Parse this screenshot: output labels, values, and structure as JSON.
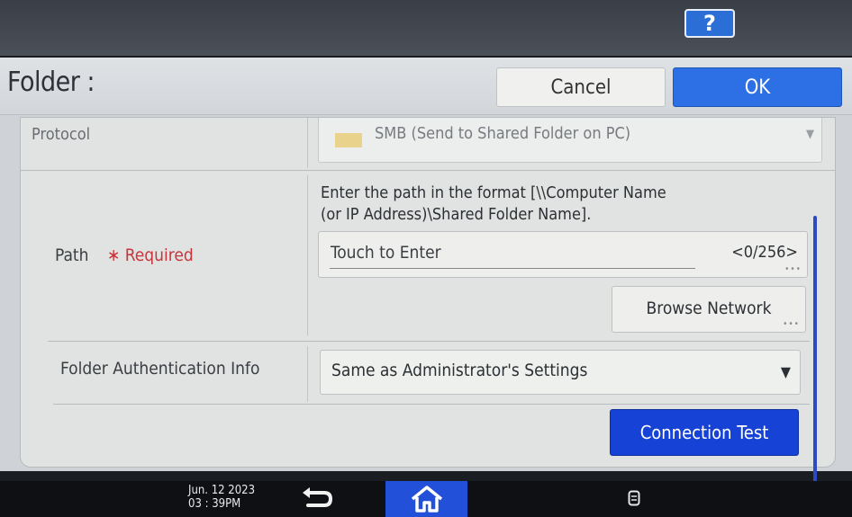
{
  "help_button_label": "?",
  "dialog": {
    "title": "Folder :",
    "cancel_label": "Cancel",
    "ok_label": "OK"
  },
  "protocol": {
    "label": "Protocol",
    "value": "SMB (Send to Shared Folder on PC)"
  },
  "path": {
    "label": "Path",
    "required_text": "∗ Required",
    "hint_line1": "Enter the path in the format [\\\\Computer Name",
    "hint_line2": "(or IP Address)\\Shared Folder Name].",
    "placeholder": "Touch to Enter",
    "counter": "<0/256>",
    "browse_label": "Browse Network"
  },
  "auth": {
    "label": "Folder Authentication Info",
    "value": "Same as Administrator's Settings"
  },
  "connection_test_label": "Connection Test",
  "status_bar": {
    "date": "Jun. 12 2023",
    "time": "03 : 39PM"
  },
  "icons": [
    "help-icon",
    "folder-icon",
    "chevron-down-icon",
    "back-icon",
    "home-icon",
    "memory-icon"
  ],
  "colors": {
    "ok_button": "#2d6fe4",
    "connection_test_button": "#1742d6",
    "home_button": "#2250d8",
    "required_text": "#c8343a",
    "help_button": "#2b6fd6"
  }
}
